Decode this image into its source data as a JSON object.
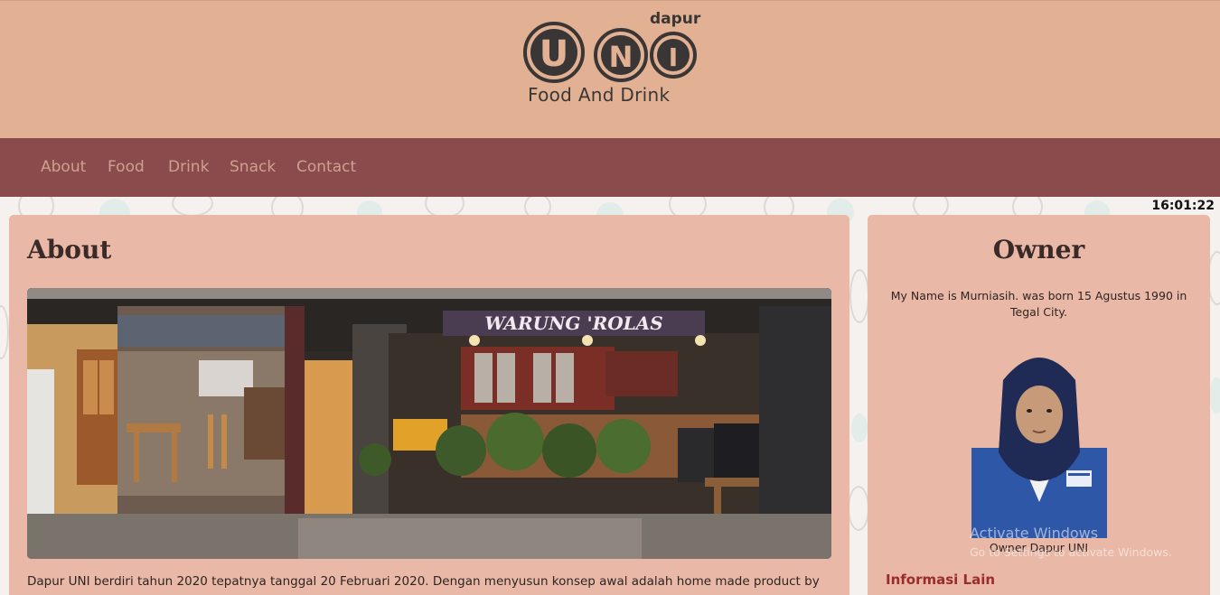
{
  "header": {
    "logo_small": "dapur",
    "logo_letters": [
      "U",
      "N",
      "I"
    ],
    "tagline": "Food And Drink"
  },
  "nav": {
    "items": [
      {
        "label": "About"
      },
      {
        "label": "Food"
      },
      {
        "label": "Drink"
      },
      {
        "label": "Snack"
      },
      {
        "label": "Contact"
      }
    ]
  },
  "clock": "16:01:22",
  "about": {
    "title": "About",
    "photo_sign": "WARUNG 'ROLAS",
    "text": "Dapur UNI berdiri tahun 2020 tepatnya tanggal 20 Februari 2020. Dengan menyusun konsep awal adalah home made product by"
  },
  "owner": {
    "title": "Owner",
    "description": "My Name is Murniasih. was born 15 Agustus 1990 in Tegal City.",
    "caption": "Owner Dapur UNI",
    "info_title": "Informasi Lain"
  },
  "watermark": {
    "line1": "Activate Windows",
    "line2": "Go to Settings to activate Windows."
  },
  "colors": {
    "header_bg": "#e2b194",
    "nav_bg": "#8a4b4c",
    "card_bg": "#e9b8a6",
    "accent_red": "#9a2c2c"
  }
}
